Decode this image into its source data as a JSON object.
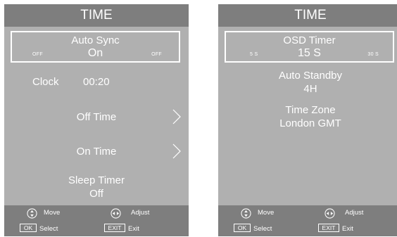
{
  "left_panel": {
    "title": "TIME",
    "selector": {
      "title": "Auto Sync",
      "value": "On",
      "min_label": "OFF",
      "max_label": "OFF"
    },
    "clock": {
      "label": "Clock",
      "value": "00:20"
    },
    "off_time": {
      "label": "Off Time",
      "icon": "chevron-right-icon"
    },
    "on_time": {
      "label": "On Time",
      "icon": "chevron-right-icon"
    },
    "sleep_timer": {
      "label": "Sleep Timer",
      "value": "Off"
    },
    "footer": {
      "move": "Move",
      "adjust": "Adjust",
      "ok_key": "OK",
      "select": "Select",
      "exit_key": "EXIT",
      "exit": "Exit"
    }
  },
  "right_panel": {
    "title": "TIME",
    "selector": {
      "title": "OSD Timer",
      "value": "15 S",
      "min_label": "5 S",
      "max_label": "30 S"
    },
    "auto_standby": {
      "label": "Auto Standby",
      "value": "4H"
    },
    "time_zone": {
      "label": "Time Zone",
      "value": "London GMT"
    },
    "footer": {
      "move": "Move",
      "adjust": "Adjust",
      "ok_key": "OK",
      "select": "Select",
      "exit_key": "EXIT",
      "exit": "Exit"
    }
  },
  "colors": {
    "panel_bg": "#b0b0b0",
    "header_bg": "#7e7e7e",
    "text": "#ffffff"
  }
}
